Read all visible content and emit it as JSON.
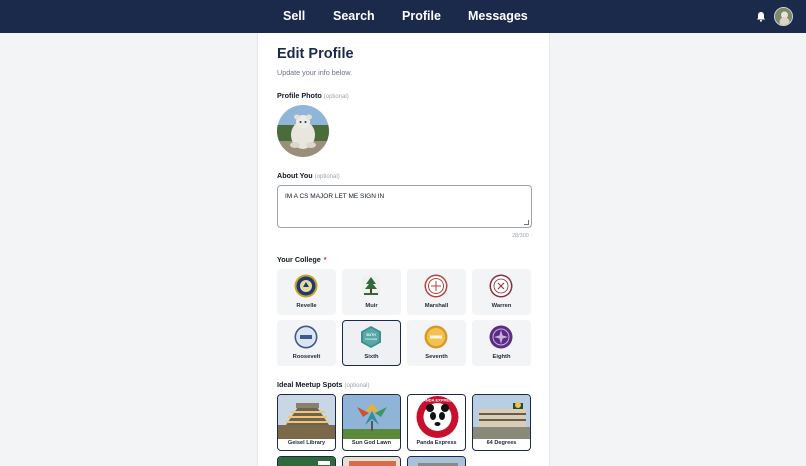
{
  "nav": {
    "links": [
      "Sell",
      "Search",
      "Profile",
      "Messages"
    ],
    "icons": [
      "bell-icon",
      "avatar"
    ]
  },
  "page": {
    "title": "Edit Profile",
    "subtitle": "Update your info below."
  },
  "photo": {
    "label": "Profile Photo",
    "optional": "(optional)"
  },
  "about": {
    "label": "About You",
    "optional": "(optional)",
    "value": "IM A CS MAJOR LET ME SIGN IN",
    "counter": "28/300"
  },
  "college": {
    "label": "Your College",
    "required": "*",
    "selected": "Sixth",
    "options": [
      "Revelle",
      "Muir",
      "Marshall",
      "Warren",
      "Roosevelt",
      "Sixth",
      "Seventh",
      "Eighth"
    ],
    "badge_text": "SIXTH COLLEGE"
  },
  "meetup": {
    "label": "Ideal Meetup Spots",
    "optional": "(optional)",
    "spots": [
      "Geisel Library",
      "Sun God Lawn",
      "Panda Express",
      "64 Degrees"
    ],
    "logo_text": "PANDA EXPRESS"
  },
  "colors": {
    "navy": "#1b2a4a",
    "required": "#dc2626"
  }
}
